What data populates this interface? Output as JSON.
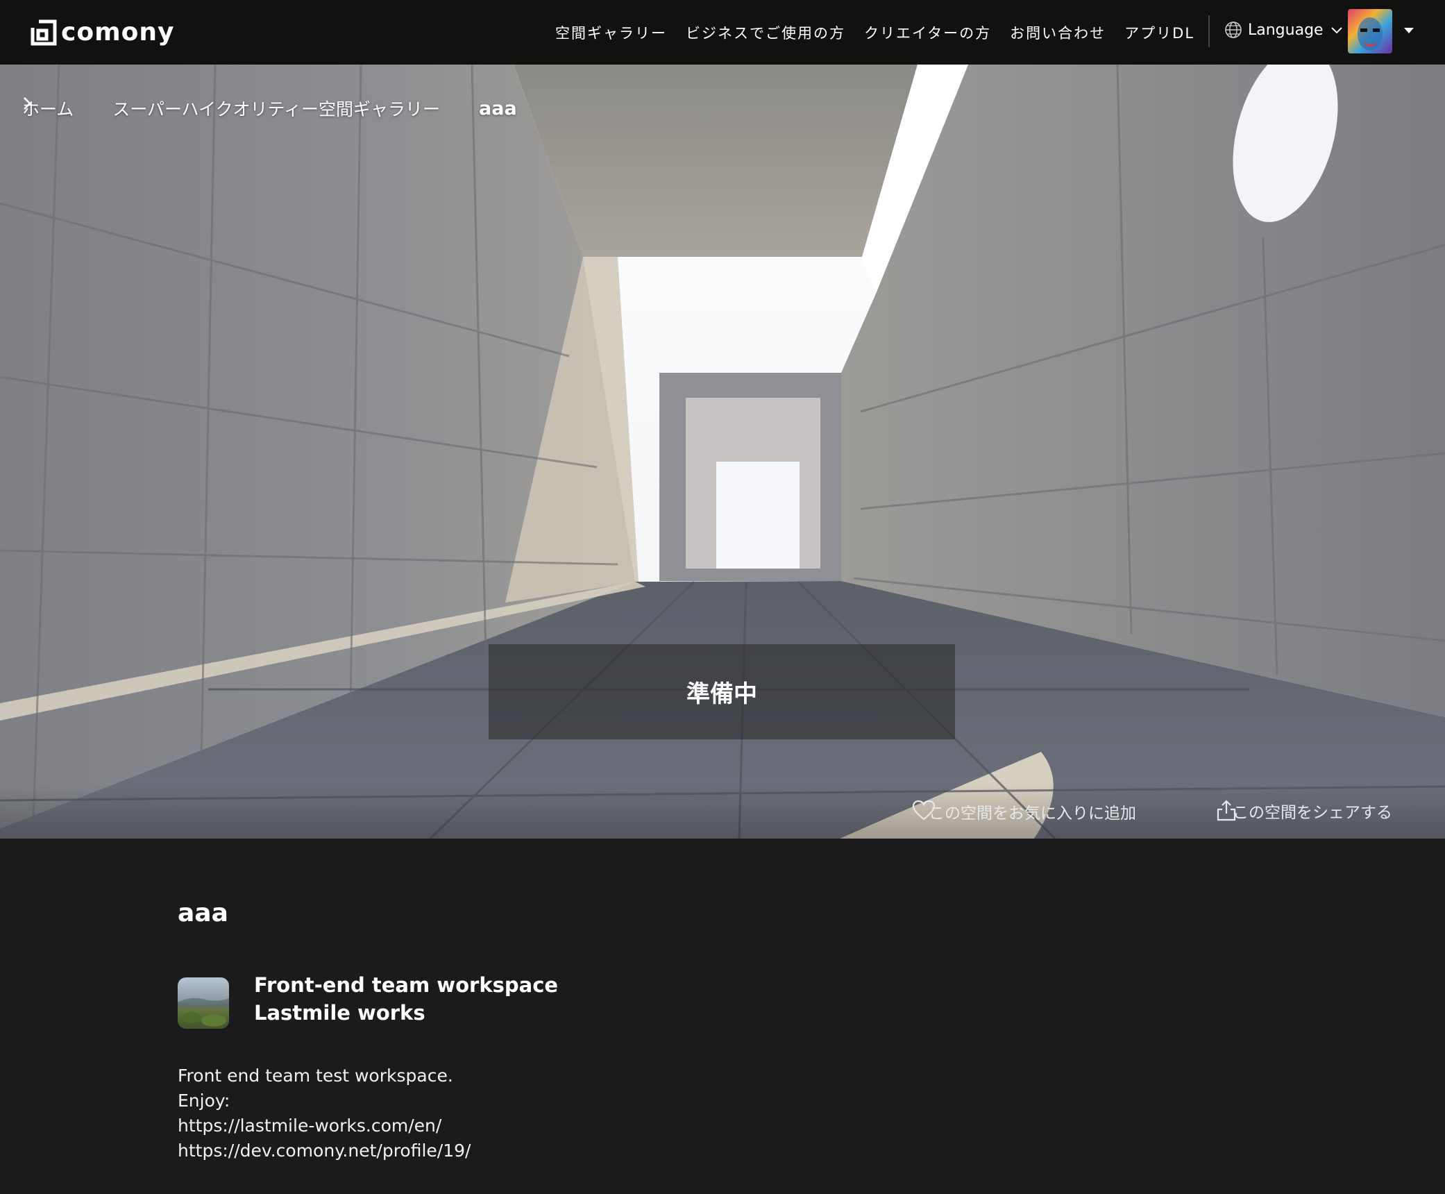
{
  "header": {
    "logo_text": "comony",
    "nav": [
      {
        "label": "空間ギャラリー"
      },
      {
        "label": "ビジネスでご使用の方"
      },
      {
        "label": "クリエイターの方"
      },
      {
        "label": "お問い合わせ"
      },
      {
        "label": "アプリDL"
      }
    ],
    "language_label": "Language",
    "icons": {
      "language": "globe-icon",
      "dropdown": "chevron-down-icon",
      "avatar_menu": "caret-down-icon"
    }
  },
  "breadcrumb": {
    "items": [
      "ホーム",
      "スーパーハイクオリティー空間ギャラリー"
    ],
    "current": "aaa"
  },
  "hero": {
    "status_text": "準備中",
    "favorite_label": "この空間をお気に入りに追加",
    "share_label": "この空間をシェアする",
    "icons": {
      "favorite": "heart-icon",
      "share": "share-icon"
    }
  },
  "space": {
    "title": "aaa",
    "owner_name": "Front-end team workspace",
    "owner_org": "Lastmile works",
    "description": [
      "Front end team test workspace.",
      "Enjoy:",
      "https://lastmile-works.com/en/",
      "https://dev.comony.net/profile/19/"
    ]
  },
  "colors": {
    "header_bg": "#111110",
    "page_bg": "#1b1b1d",
    "text": "#ffffff"
  }
}
